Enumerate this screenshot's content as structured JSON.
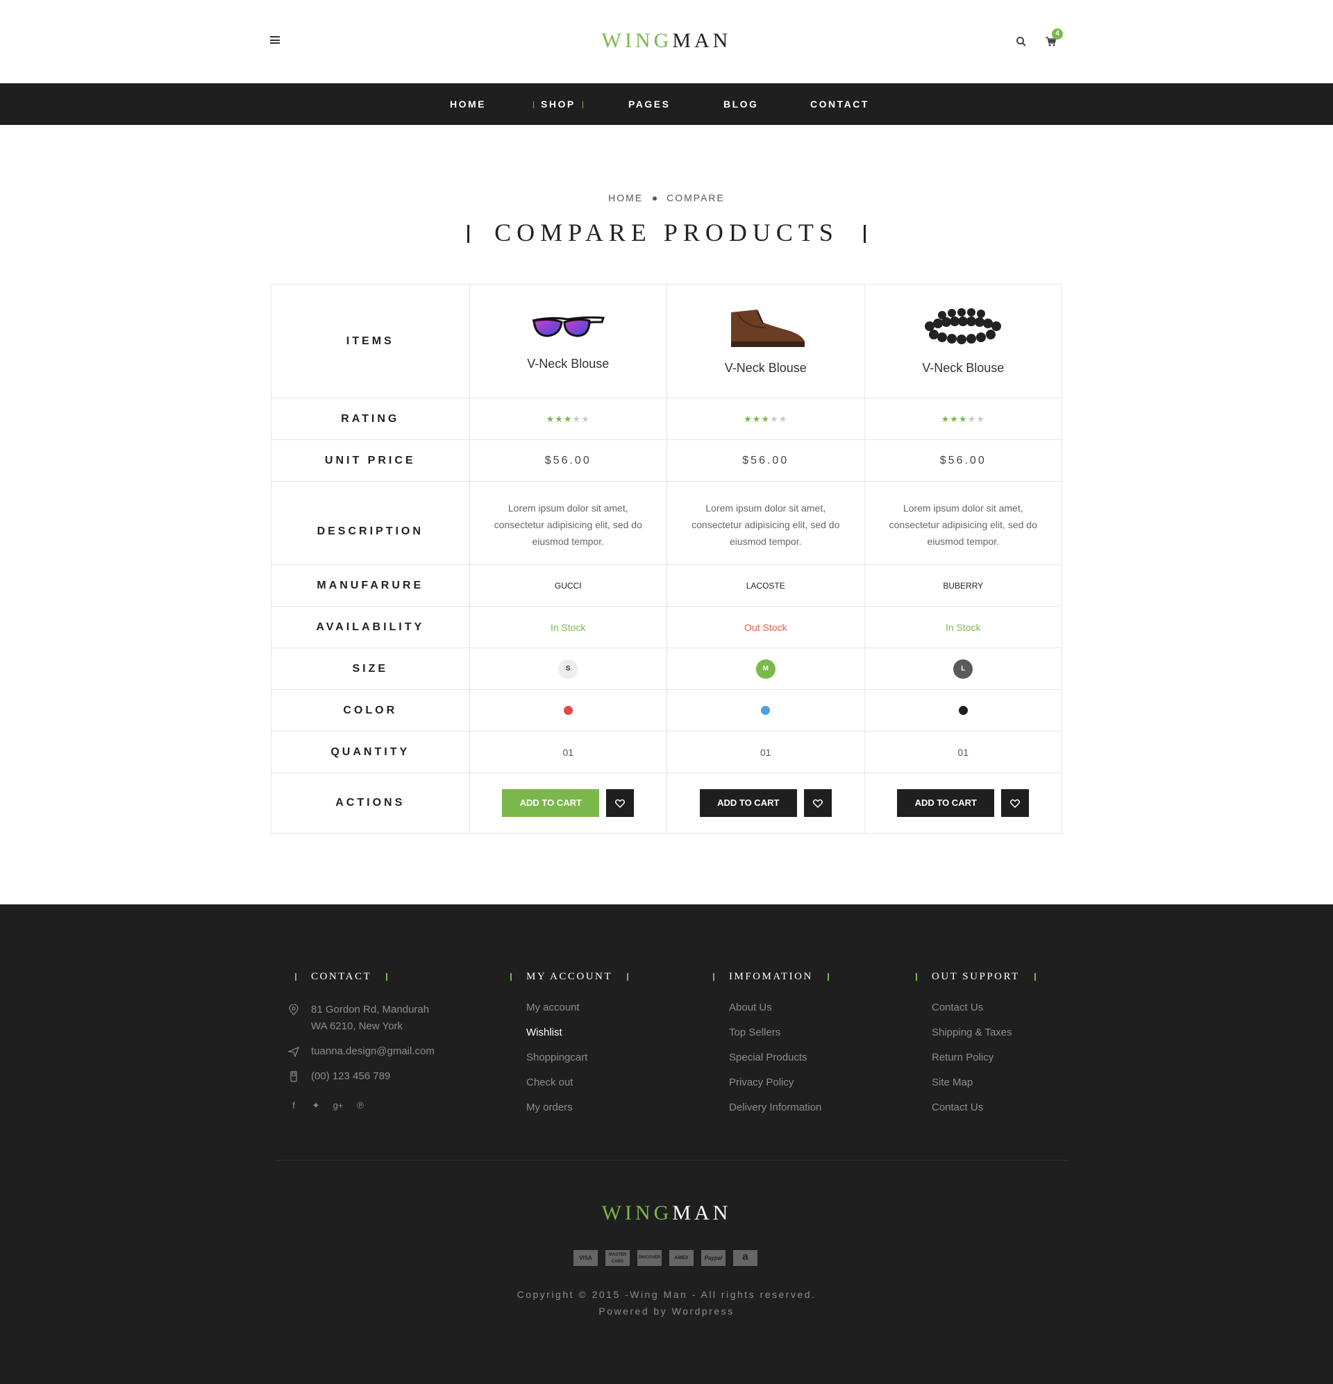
{
  "header": {
    "logo_part1": "WING",
    "logo_part2": "MAN",
    "cart_count": "4"
  },
  "nav": [
    {
      "label": "HOME"
    },
    {
      "label": "SHOP"
    },
    {
      "label": "PAGES"
    },
    {
      "label": "BLOG"
    },
    {
      "label": "CONTACT"
    }
  ],
  "breadcrumb": {
    "home": "HOME",
    "current": "COMPARE"
  },
  "page_title": "COMPARE PRODUCTS",
  "compare": {
    "labels": {
      "items": "ITEMS",
      "rating": "RATING",
      "price": "UNIT PRICE",
      "description": "DESCRIPTION",
      "manufacture": "MANUFARURE",
      "availability": "AVAILABILITY",
      "size": "SIZE",
      "color": "COLOR",
      "quantity": "QUANTITY",
      "actions": "ACTIONS"
    },
    "products": [
      {
        "name": "V-Neck Blouse",
        "image_icon": "sunglasses-image",
        "rating": 3,
        "rating_max": 5,
        "price": "$56.00",
        "description": "Lorem ipsum dolor sit amet, consectetur adipisicing elit, sed do eiusmod tempor.",
        "manufacturer": "GUCCI",
        "availability": "In Stock",
        "availability_color": "#7ab84b",
        "size": "S",
        "size_bg": "#ececec",
        "size_fg": "#333333",
        "color": "#e04a4a",
        "quantity": "01",
        "add_to_cart": "ADD TO CART",
        "cart_bg": "#7ab84b"
      },
      {
        "name": "V-Neck Blouse",
        "image_icon": "shoe-image",
        "rating": 3,
        "rating_max": 5,
        "price": "$56.00",
        "description": "Lorem ipsum dolor sit amet, consectetur adipisicing elit, sed do eiusmod tempor.",
        "manufacturer": "LACOSTE",
        "availability": "Out Stock",
        "availability_color": "#e05a4a",
        "size": "M",
        "size_bg": "#7ab84b",
        "size_fg": "#ffffff",
        "color": "#4aa3e0",
        "quantity": "01",
        "add_to_cart": "ADD TO CART",
        "cart_bg": "#1f1f1f"
      },
      {
        "name": "V-Neck Blouse",
        "image_icon": "bracelet-image",
        "rating": 3,
        "rating_max": 5,
        "price": "$56.00",
        "description": "Lorem ipsum dolor sit amet, consectetur adipisicing elit, sed do eiusmod tempor.",
        "manufacturer": "BUBERRY",
        "availability": "In Stock",
        "availability_color": "#7ab84b",
        "size": "L",
        "size_bg": "#5a5a5a",
        "size_fg": "#ffffff",
        "color": "#1f1f1f",
        "quantity": "01",
        "add_to_cart": "ADD TO CART",
        "cart_bg": "#1f1f1f"
      }
    ]
  },
  "footer": {
    "contact": {
      "title": "CONTACT",
      "address_line1": "81 Gordon Rd, Mandurah",
      "address_line2": "WA 6210, New York",
      "email": "tuanna.design@gmail.com",
      "phone": "(00) 123 456 789"
    },
    "account": {
      "title": "MY ACCOUNT",
      "links": [
        "My account",
        "Wishlist",
        "Shoppingcart",
        "Check out",
        "My orders"
      ]
    },
    "information": {
      "title": "IMFOMATION",
      "links": [
        "About Us",
        "Top Sellers",
        "Special Products",
        "Privacy Policy",
        "Delivery Information"
      ]
    },
    "support": {
      "title": "OUT SUPPORT",
      "links": [
        "Contact Us",
        "Shipping & Taxes",
        "Return Policy",
        "Site Map",
        "Contact Us"
      ]
    },
    "logo_part1": "WING",
    "logo_part2": "MAN",
    "payments": [
      "VISA",
      "MASTER CARD",
      "DISCOVER",
      "AMEX",
      "Paypal",
      "a"
    ],
    "copyright": "Copyright © 2015 -Wing Man - All rights reserved.",
    "powered": "Powered by Wordpress"
  },
  "colors": {
    "accent": "#7ab84b",
    "dark": "#1f1f1f"
  }
}
